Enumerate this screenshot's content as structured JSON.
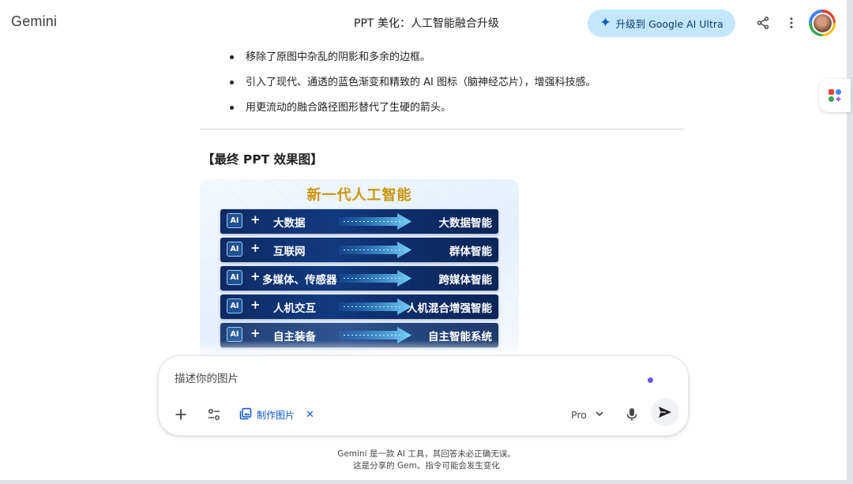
{
  "app": {
    "brand": "Gemini"
  },
  "header": {
    "chat_title": "PPT 美化：人工智能融合升级",
    "upgrade_label": "升级到 Google AI Ultra"
  },
  "content": {
    "bullets": [
      "移除了原图中杂乱的阴影和多余的边框。",
      "引入了现代、通透的蓝色渐变和精致的 AI 图标（脑神经芯片），增强科技感。",
      "用更流动的融合路径图形替代了生硬的箭头。"
    ],
    "section_heading": "【最终 PPT 效果图】",
    "image": {
      "title": "新一代人工智能",
      "rows": [
        {
          "chip": "AI",
          "plus": "+",
          "input": "大数据",
          "output": "大数据智能"
        },
        {
          "chip": "AI",
          "plus": "+",
          "input": "互联网",
          "output": "群体智能"
        },
        {
          "chip": "AI",
          "plus": "+",
          "input": "多媒体、传感器",
          "output": "跨媒体智能"
        },
        {
          "chip": "AI",
          "plus": "+",
          "input": "人机交互",
          "output": "人机混合增强智能"
        },
        {
          "chip": "AI",
          "plus": "+",
          "input": "自主装备",
          "output": "自主智能系统"
        }
      ]
    }
  },
  "composer": {
    "placeholder": "描述你的图片",
    "tool_chip_label": "制作图片",
    "model": "Pro"
  },
  "footer": {
    "line1": "Gemini 是一款 AI 工具，其回答未必正确无误。",
    "line2": "这是分享的 Gem。指令可能会发生变化"
  },
  "colors": {
    "upgrade_bg": "#c2e7ff",
    "accent_blue": "#0b57d0",
    "slide_title_gold": "#c8940d",
    "slide_row_navy": "#0e2a63"
  },
  "icons": [
    "sparkle-icon",
    "share-icon",
    "more-vert-icon",
    "avatar",
    "gem-app-icon",
    "plus-icon",
    "tools-icon",
    "image-gen-icon",
    "close-icon",
    "chevron-down-icon",
    "mic-icon",
    "send-icon"
  ]
}
